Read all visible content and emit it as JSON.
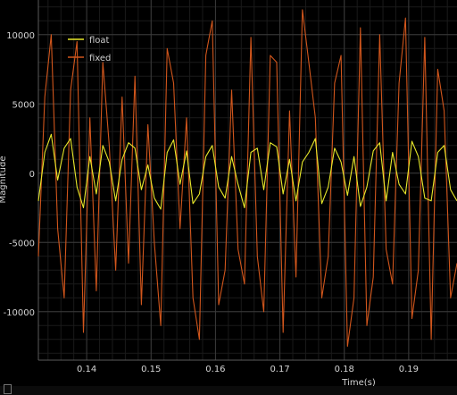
{
  "chart_data": {
    "type": "line",
    "xlabel": "Time(s)",
    "ylabel": "Magnitude",
    "xlim": [
      0.1325,
      0.1975
    ],
    "ylim": [
      -13500,
      12500
    ],
    "xticks": [
      0.14,
      0.15,
      0.16,
      0.17,
      0.18,
      0.19
    ],
    "xtick_labels": [
      "0.14",
      "0.15",
      "0.16",
      "0.17",
      "0.18",
      "0.19"
    ],
    "yticks": [
      10000,
      5000,
      0,
      -5000,
      -10000
    ],
    "ytick_labels": [
      "10000",
      "5000",
      "0",
      "-5000",
      "-10000"
    ],
    "grid": true,
    "legend_position": "top-left",
    "series": [
      {
        "name": "float",
        "color": "#e8e82a",
        "x": [
          0.1325,
          0.1335,
          0.1345,
          0.1355,
          0.1365,
          0.1375,
          0.1385,
          0.1395,
          0.1405,
          0.1415,
          0.1425,
          0.1435,
          0.1445,
          0.1455,
          0.1465,
          0.1475,
          0.1485,
          0.1495,
          0.1505,
          0.1515,
          0.1525,
          0.1535,
          0.1545,
          0.1555,
          0.1565,
          0.1575,
          0.1585,
          0.1595,
          0.1605,
          0.1615,
          0.1625,
          0.1635,
          0.1645,
          0.1655,
          0.1665,
          0.1675,
          0.1685,
          0.1695,
          0.1705,
          0.1715,
          0.1725,
          0.1735,
          0.1745,
          0.1755,
          0.1765,
          0.1775,
          0.1785,
          0.1795,
          0.1805,
          0.1815,
          0.1825,
          0.1835,
          0.1845,
          0.1855,
          0.1865,
          0.1875,
          0.1885,
          0.1895,
          0.1905,
          0.1915,
          0.1925,
          0.1935,
          0.1945,
          0.1955,
          0.1965,
          0.1975
        ],
        "y": [
          -2000,
          1500,
          2800,
          -500,
          1800,
          2500,
          -1000,
          -2500,
          1200,
          -1500,
          2000,
          800,
          -2000,
          1000,
          2200,
          1800,
          -1200,
          600,
          -1800,
          -2600,
          1500,
          2400,
          -800,
          1600,
          -2200,
          -1500,
          1200,
          2000,
          -1000,
          -1800,
          1200,
          -800,
          -2500,
          1500,
          1800,
          -1200,
          2200,
          1900,
          -1500,
          1000,
          -2000,
          800,
          1500,
          2500,
          -2200,
          -1000,
          1800,
          800,
          -1600,
          1200,
          -2400,
          -1000,
          1600,
          2200,
          -2000,
          1500,
          -800,
          -1500,
          2300,
          1200,
          -1800,
          -2000,
          1500,
          2000,
          -1200,
          -2000
        ]
      },
      {
        "name": "fixed",
        "color": "#d1561c",
        "x": [
          0.1325,
          0.1335,
          0.1345,
          0.1355,
          0.1365,
          0.1375,
          0.1385,
          0.1395,
          0.1405,
          0.1415,
          0.1425,
          0.1435,
          0.1445,
          0.1455,
          0.1465,
          0.1475,
          0.1485,
          0.1495,
          0.1505,
          0.1515,
          0.1525,
          0.1535,
          0.1545,
          0.1555,
          0.1565,
          0.1575,
          0.1585,
          0.1595,
          0.1605,
          0.1615,
          0.1625,
          0.1635,
          0.1645,
          0.1655,
          0.1665,
          0.1675,
          0.1685,
          0.1695,
          0.1705,
          0.1715,
          0.1725,
          0.1735,
          0.1745,
          0.1755,
          0.1765,
          0.1775,
          0.1785,
          0.1795,
          0.1805,
          0.1815,
          0.1825,
          0.1835,
          0.1845,
          0.1855,
          0.1865,
          0.1875,
          0.1885,
          0.1895,
          0.1905,
          0.1915,
          0.1925,
          0.1935,
          0.1945,
          0.1955,
          0.1965,
          0.1975
        ],
        "y": [
          -6000,
          5500,
          10000,
          -4000,
          -9000,
          6000,
          9500,
          -11500,
          4000,
          -8500,
          8000,
          2000,
          -7000,
          5500,
          -6500,
          7000,
          -9500,
          3500,
          -5000,
          -11000,
          9000,
          6500,
          -4000,
          4000,
          -9000,
          -12000,
          8500,
          11000,
          -9500,
          -7000,
          6000,
          -5500,
          -8000,
          9800,
          -6000,
          -10000,
          8500,
          8000,
          -11500,
          4500,
          -7500,
          11800,
          8000,
          4000,
          -9000,
          -6000,
          6500,
          8500,
          -12500,
          -9000,
          10500,
          -11000,
          -7500,
          10000,
          -5500,
          -8000,
          6500,
          11200,
          -10500,
          -7000,
          9800,
          -12000,
          7500,
          4500,
          -9000,
          -6500
        ]
      }
    ]
  }
}
